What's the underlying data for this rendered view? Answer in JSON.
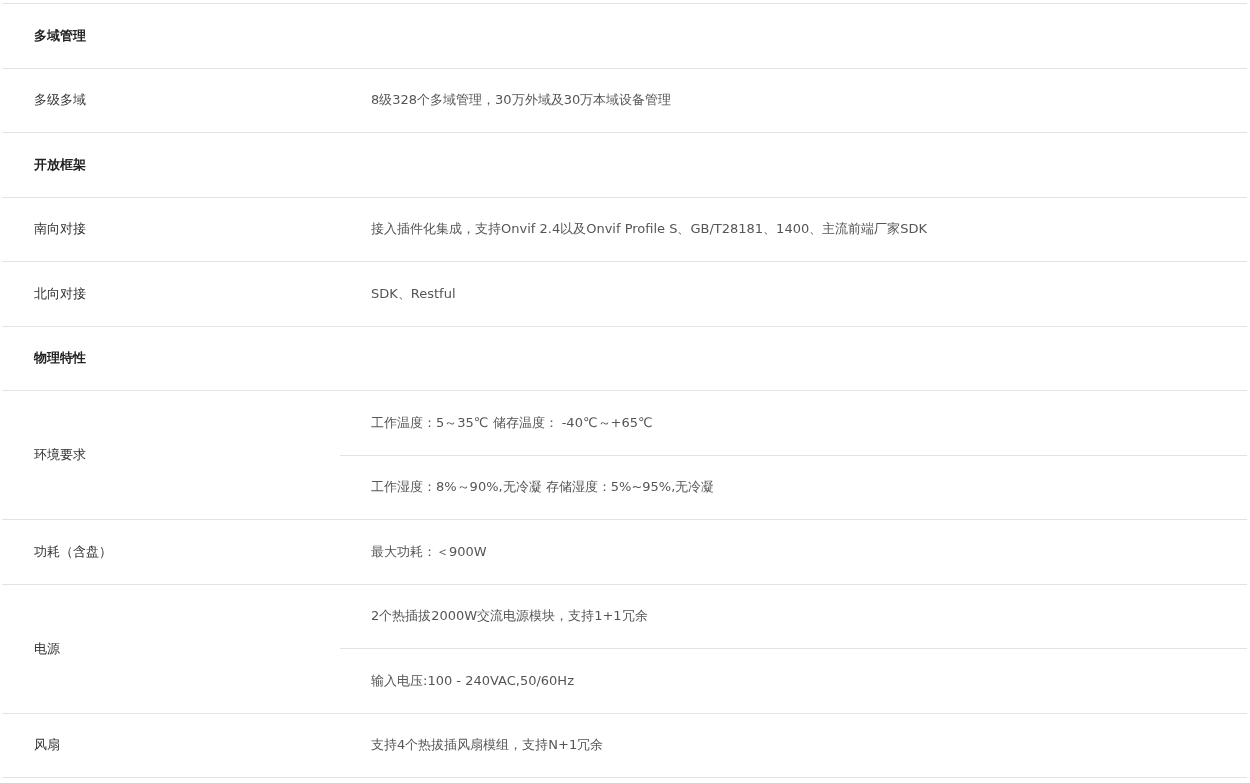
{
  "rows": [
    {
      "kind": "section",
      "label": "多域管理"
    },
    {
      "kind": "item",
      "label": "多级多域",
      "values": [
        "8级328个多域管理，30万外域及30万本域设备管理"
      ]
    },
    {
      "kind": "section",
      "label": "开放框架"
    },
    {
      "kind": "item",
      "label": "南向对接",
      "values": [
        "接入插件化集成，支持Onvif 2.4以及Onvif Profile S、GB/T28181、1400、主流前端厂家SDK"
      ]
    },
    {
      "kind": "item",
      "label": "北向对接",
      "values": [
        "SDK、Restful"
      ]
    },
    {
      "kind": "section",
      "label": "物理特性"
    },
    {
      "kind": "item",
      "label": "环境要求",
      "values": [
        "工作温度：5～35℃ 储存温度： -40℃～+65℃",
        "工作湿度：8%～90%,无冷凝 存储湿度：5%~95%,无冷凝"
      ]
    },
    {
      "kind": "item",
      "label": "功耗（含盘）",
      "values": [
        "最大功耗：＜900W"
      ]
    },
    {
      "kind": "item",
      "label": "电源",
      "values": [
        "2个热插拔2000W交流电源模块，支持1+1冗余",
        "输入电压:100 - 240VAC,50/60Hz"
      ]
    },
    {
      "kind": "item",
      "label": "风扇",
      "values": [
        "支持4个热拔插风扇模组，支持N+1冗余"
      ]
    }
  ]
}
